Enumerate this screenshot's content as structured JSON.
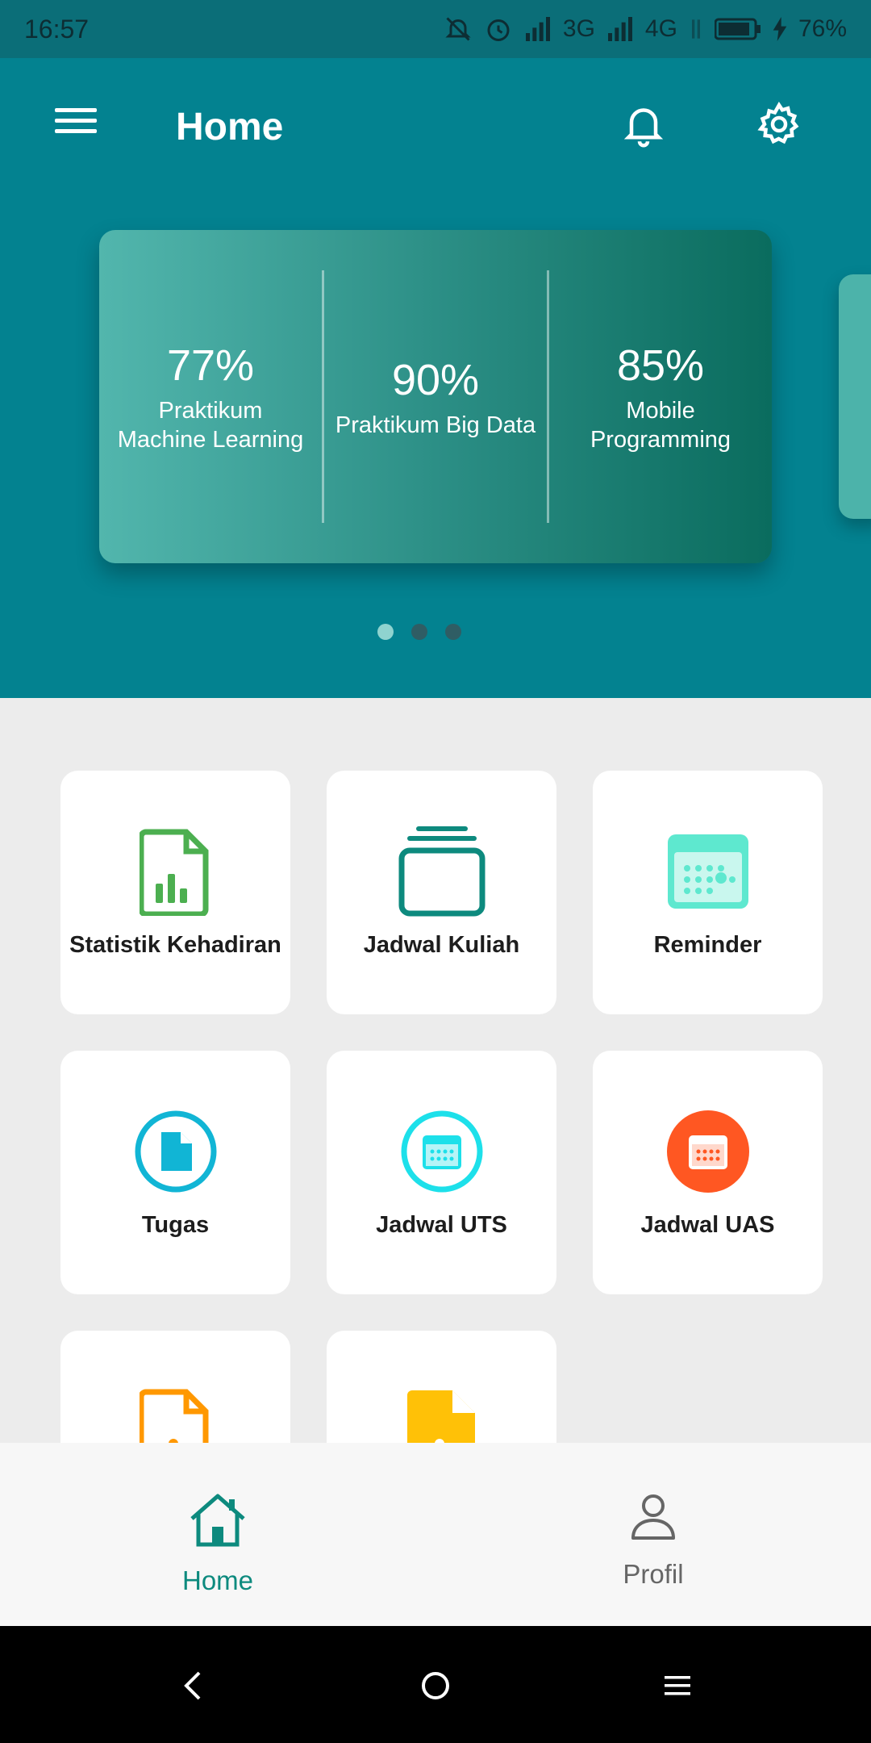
{
  "status_bar": {
    "time": "16:57",
    "net1": "3G",
    "net2": "4G",
    "battery": "76%"
  },
  "app_bar": {
    "title": "Home"
  },
  "carousel": {
    "stats": [
      {
        "value": "77%",
        "label_line1": "Praktikum",
        "label_line2": "Machine Learning"
      },
      {
        "value": "90%",
        "label_line1": "Praktikum Big Data",
        "label_line2": ""
      },
      {
        "value": "85%",
        "label_line1": "Mobile",
        "label_line2": "Programming"
      }
    ],
    "page_count": 3,
    "active_page": 1
  },
  "menu": {
    "items": [
      {
        "label": "Statistik Kehadiran",
        "icon": "chart-document-icon",
        "color": "#4caf50"
      },
      {
        "label": "Jadwal Kuliah",
        "icon": "stacked-cards-icon",
        "color": "#0d8a7e"
      },
      {
        "label": "Reminder",
        "icon": "calendar-icon",
        "color": "#5ee8cf"
      },
      {
        "label": "Tugas",
        "icon": "document-circle-icon",
        "color": "#11b5d5"
      },
      {
        "label": "Jadwal UTS",
        "icon": "calendar-circle-icon",
        "color": "#1de0ea"
      },
      {
        "label": "Jadwal UAS",
        "icon": "calendar-circle-filled-icon",
        "color": "#ff5722"
      },
      {
        "label": "",
        "icon": "document-orange-icon",
        "color": "#ff9800"
      },
      {
        "label": "",
        "icon": "document-yellow-icon",
        "color": "#ffc107"
      }
    ]
  },
  "bottom_nav": {
    "home_label": "Home",
    "profile_label": "Profil",
    "active_color": "#0d8a7e",
    "inactive_color": "#666666"
  }
}
